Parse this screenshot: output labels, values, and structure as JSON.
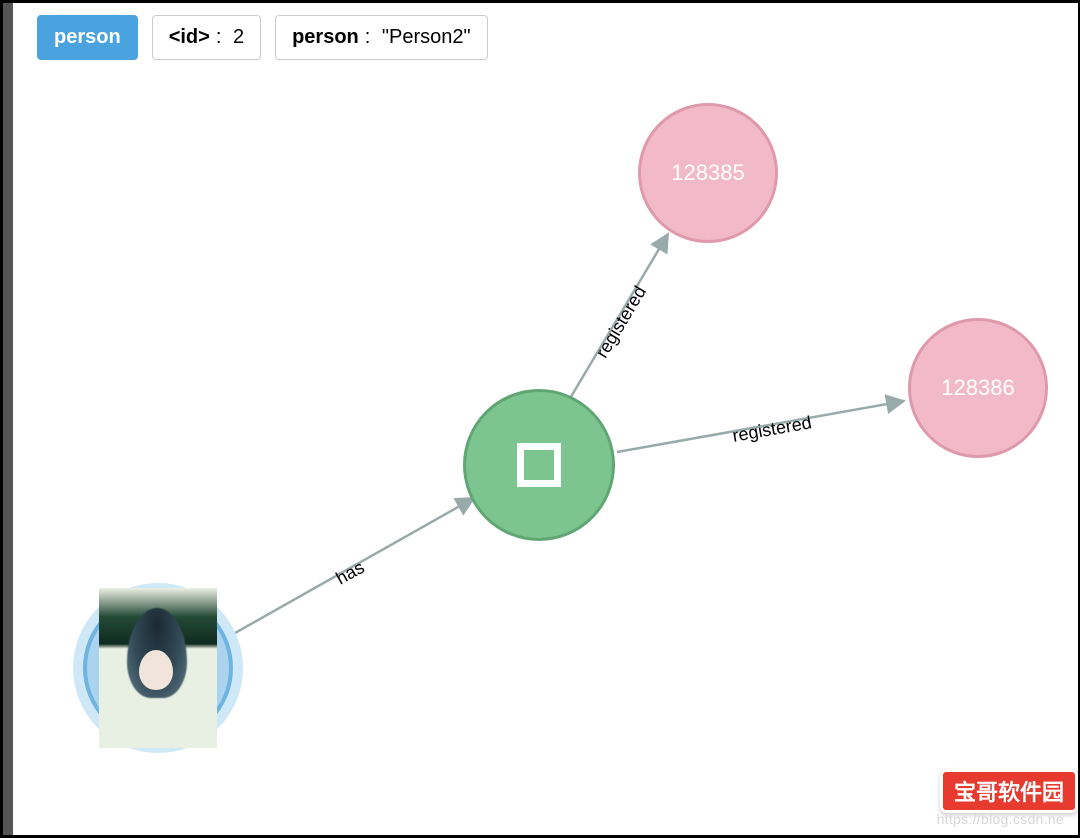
{
  "header": {
    "type": "person",
    "id_key": "<id>",
    "id_value": "2",
    "prop_key": "person",
    "prop_value": "\"Person2\""
  },
  "graph": {
    "nodes": [
      {
        "id": "128385",
        "label": "128385",
        "kind": "pink"
      },
      {
        "id": "128386",
        "label": "128386",
        "kind": "pink"
      },
      {
        "id": "center",
        "label": "",
        "kind": "green",
        "icon": "stop-square"
      },
      {
        "id": "avatar",
        "label": "",
        "kind": "avatar"
      }
    ],
    "edges": [
      {
        "from": "avatar",
        "to": "center",
        "label": "has"
      },
      {
        "from": "center",
        "to": "128385",
        "label": "registered"
      },
      {
        "from": "center",
        "to": "128386",
        "label": "registered"
      }
    ]
  },
  "footer": {
    "badge": "宝哥软件园",
    "watermark": "https://blog.csdn.ne"
  },
  "colors": {
    "primary": "#4aa3df",
    "pink_fill": "#f2bac8",
    "pink_stroke": "#df99ab",
    "green_fill": "#7cc490",
    "green_stroke": "#5fa673",
    "edge": "#99aaaa",
    "badge": "#e63b2e"
  }
}
